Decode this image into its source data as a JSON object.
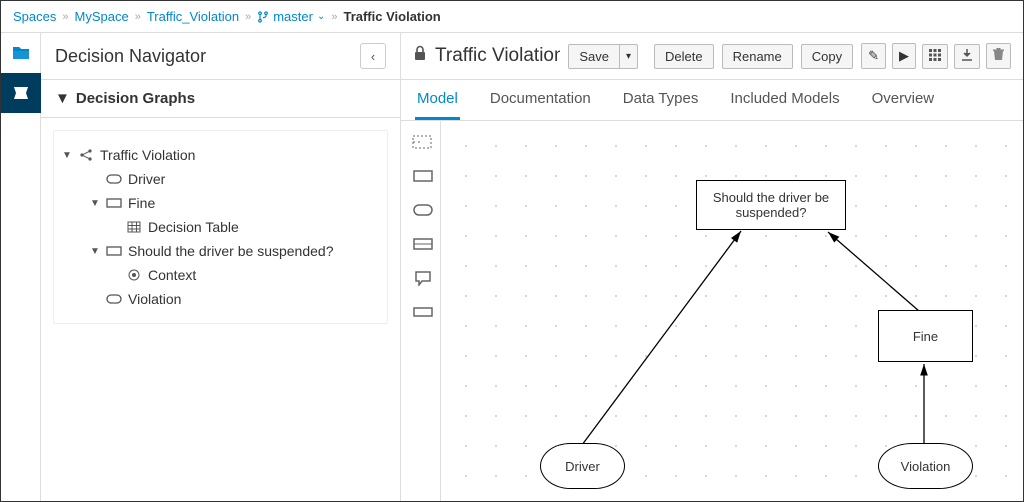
{
  "breadcrumb": {
    "items": [
      "Spaces",
      "MySpace",
      "Traffic_Violation"
    ],
    "branch": "master",
    "current": "Traffic Violation"
  },
  "sidebar": {
    "title": "Decision Navigator",
    "section": "Decision Graphs",
    "tree": {
      "root": "Traffic Violation",
      "driver": "Driver",
      "fine": "Fine",
      "fine_child": "Decision Table",
      "should": "Should the driver be suspended?",
      "should_child": "Context",
      "violation": "Violation"
    }
  },
  "editor": {
    "filename": "Traffic Violation.dmn -...",
    "buttons": {
      "save": "Save",
      "delete": "Delete",
      "rename": "Rename",
      "copy": "Copy"
    },
    "tabs": {
      "model": "Model",
      "documentation": "Documentation",
      "datatypes": "Data Types",
      "included": "Included Models",
      "overview": "Overview"
    }
  },
  "diagram": {
    "nodes": {
      "should": "Should the driver be suspended?",
      "fine": "Fine",
      "driver": "Driver",
      "violation": "Violation"
    },
    "links": [
      {
        "from": "driver",
        "to": "should"
      },
      {
        "from": "fine",
        "to": "should"
      },
      {
        "from": "violation",
        "to": "fine"
      }
    ]
  }
}
